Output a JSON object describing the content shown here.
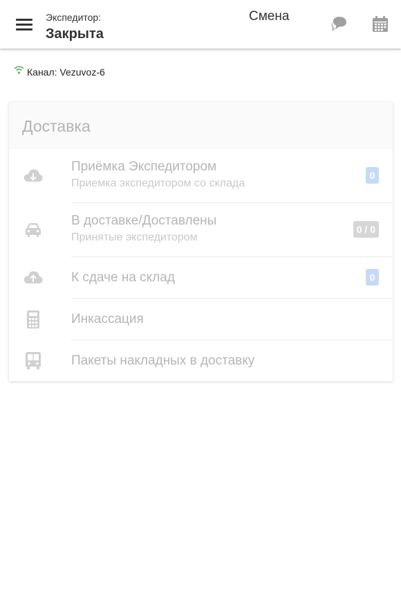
{
  "header": {
    "expeditor_label": "Экспедитор:",
    "expeditor_status": "Закрыта",
    "shift_label": "Смена",
    "menu_icon": "menu-icon",
    "chat_icon": "chat-bubbles-icon",
    "calendar_icon": "calendar-icon"
  },
  "channel": {
    "text": "Канал: Vezuvoz-6",
    "icon": "wifi-icon",
    "icon_color": "#4caf50"
  },
  "delivery": {
    "title": "Доставка",
    "items": [
      {
        "title": "Приёмка Экспедитором",
        "subtitle": "Приемка экспедитором со склада",
        "badge": "0",
        "icon": "cloud-download-icon"
      },
      {
        "title": "В доставке/Доставлены",
        "subtitle": "Принятые экспедитором",
        "badge": "0 / 0",
        "icon": "car-icon"
      },
      {
        "title": "К сдаче на склад",
        "badge": "0",
        "icon": "cloud-upload-icon"
      },
      {
        "title": "Инкассация",
        "icon": "calculator-icon"
      },
      {
        "title": "Пакеты накладных в доставку",
        "icon": "bus-icon"
      }
    ]
  },
  "colors": {
    "badge_blue": "#c6daf8",
    "badge_gray": "#d6d6d6",
    "icon_gray": "#d0d0d0",
    "header_icon_gray": "#9e9e9e"
  }
}
